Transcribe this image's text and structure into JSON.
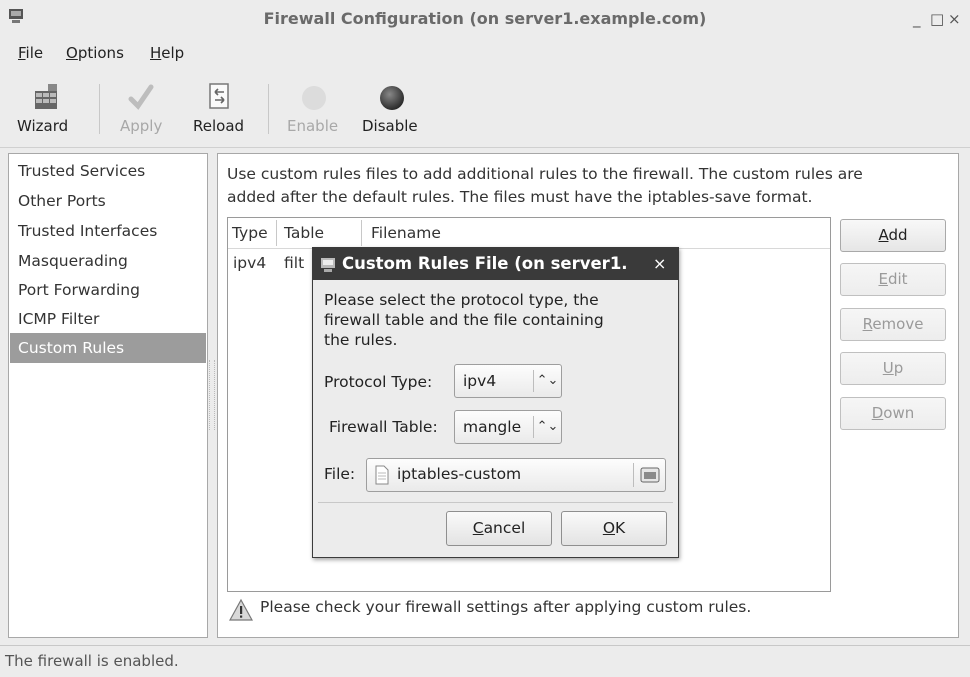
{
  "window": {
    "title": "Firewall Configuration (on server1.example.com)",
    "minimize": "_",
    "maximize": "□",
    "close": "×"
  },
  "menubar": [
    {
      "label": "File",
      "mnemonic": "F",
      "rest": "ile"
    },
    {
      "label": "Options",
      "mnemonic": "O",
      "rest": "ptions"
    },
    {
      "label": "Help",
      "mnemonic": "H",
      "rest": "elp"
    }
  ],
  "toolbar": {
    "wizard": "Wizard",
    "apply": "Apply",
    "reload": "Reload",
    "enable": "Enable",
    "disable": "Disable"
  },
  "sidebar": {
    "items": [
      {
        "label": "Trusted Services"
      },
      {
        "label": "Other Ports"
      },
      {
        "label": "Trusted Interfaces"
      },
      {
        "label": "Masquerading"
      },
      {
        "label": "Port Forwarding"
      },
      {
        "label": "ICMP Filter"
      },
      {
        "label": "Custom Rules",
        "selected": true
      }
    ]
  },
  "main": {
    "description_line1": "Use custom rules files to add additional rules to the firewall. The custom rules are",
    "description_line2": "added after the default rules. The files must have the iptables-save format.",
    "columns": [
      "Type",
      "Table",
      "Filename"
    ],
    "rows": [
      {
        "type": "ipv4",
        "table": "filt"
      }
    ],
    "buttons": {
      "add": "Add",
      "edit": "Edit",
      "remove": "Remove",
      "up": "Up",
      "down": "Down"
    },
    "warning": "Please check your firewall settings after applying custom rules."
  },
  "status": "The firewall is enabled.",
  "dialog": {
    "title": "Custom Rules File (on server1.",
    "close": "×",
    "text_line1": "Please select the protocol type, the",
    "text_line2": "firewall table and the file containing",
    "text_line3": "the rules.",
    "protocol_label": "Protocol Type:",
    "protocol_value": "ipv4",
    "table_label": "Firewall Table:",
    "table_value": "mangle",
    "file_label": "File:",
    "file_value": "iptables-custom",
    "cancel": "Cancel",
    "ok": "OK"
  }
}
